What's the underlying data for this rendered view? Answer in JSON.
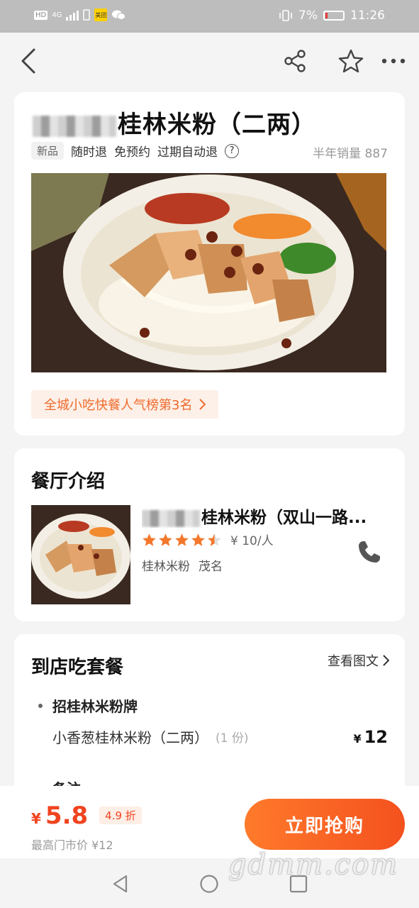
{
  "status_bar": {
    "net_chip": "HD",
    "net_type": "4G",
    "app_badge": "美团",
    "battery": "7%",
    "time": "11:26"
  },
  "product": {
    "title": "桂林米粉（二两）",
    "new_tag": "新品",
    "policies": [
      "随时退",
      "免预约",
      "过期自动退"
    ],
    "sales_label": "半年销量 887",
    "rank_label": "全城小吃快餐人气榜第3名"
  },
  "restaurant": {
    "section_title": "餐厅介绍",
    "name": "桂林米粉（双山一路...",
    "rating": 4.5,
    "price_per": "¥ 10/人",
    "categories": [
      "桂林米粉",
      "茂名"
    ]
  },
  "package": {
    "section_title": "到店吃套餐",
    "view_link": "查看图文",
    "group_title": "招桂林米粉牌",
    "item_name": "小香葱桂林米粉（二两）",
    "item_qty": "(1 份)",
    "currency": "¥",
    "item_price": "12",
    "note_title": "备注"
  },
  "purchase": {
    "currency": "¥",
    "price": "5.8",
    "discount": "4.9 折",
    "original": "最高门市价 ¥12",
    "buy_label": "立即抢购"
  },
  "watermark": "gdmm.com",
  "colors": {
    "accent": "#f0441f",
    "star": "#f4772a",
    "page_bg": "#f4f4f4"
  }
}
